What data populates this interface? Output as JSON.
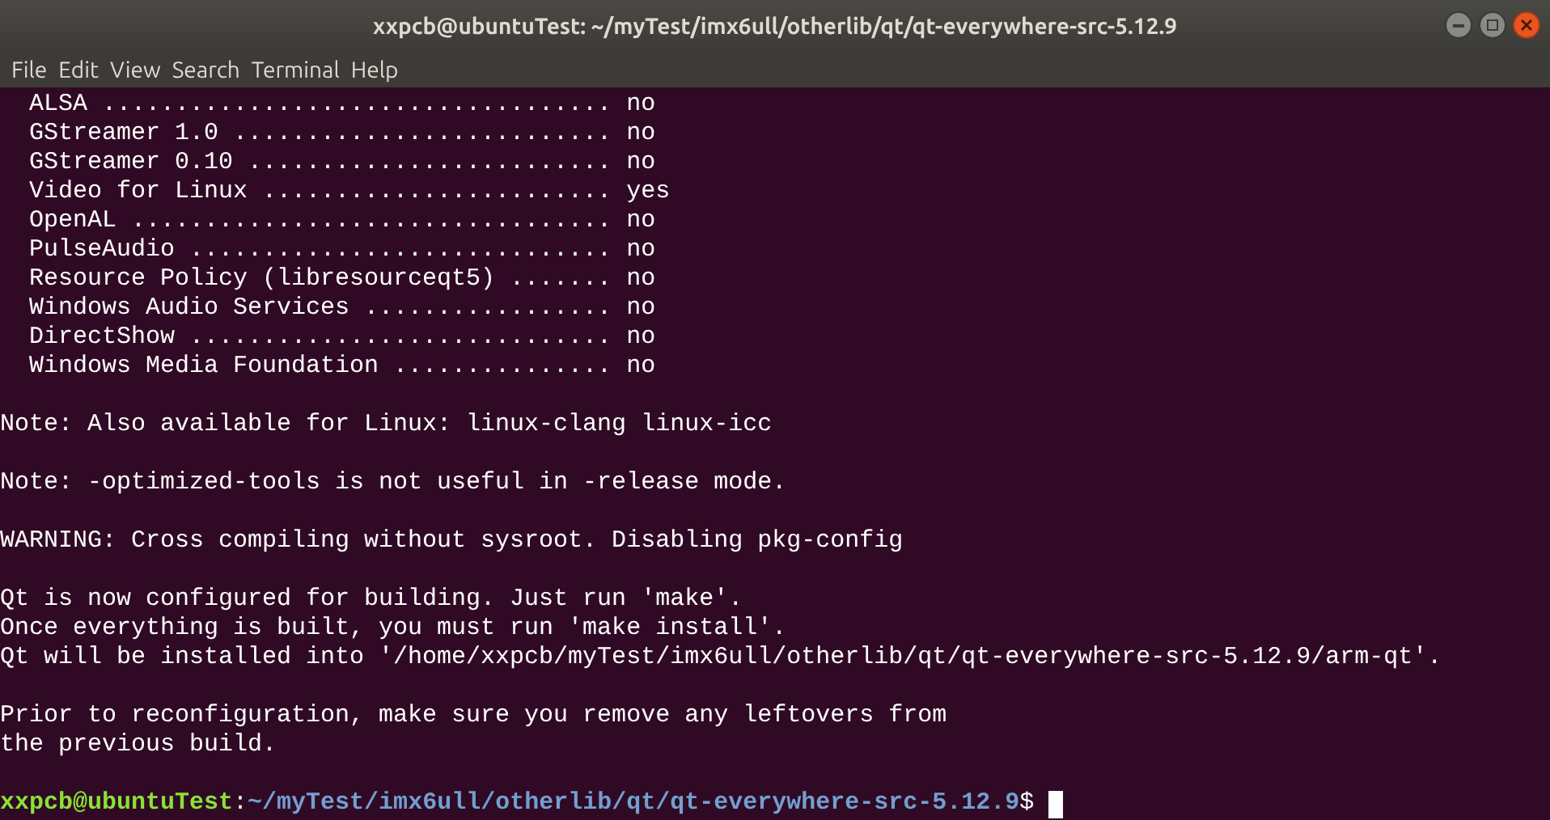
{
  "window": {
    "title": "xxpcb@ubuntuTest: ~/myTest/imx6ull/otherlib/qt/qt-everywhere-src-5.12.9"
  },
  "menu": [
    "File",
    "Edit",
    "View",
    "Search",
    "Terminal",
    "Help"
  ],
  "output_blocks": [
    [
      "  ALSA ................................... no",
      "  GStreamer 1.0 .......................... no",
      "  GStreamer 0.10 ......................... no",
      "  Video for Linux ........................ yes",
      "  OpenAL ................................. no",
      "  PulseAudio ............................. no",
      "  Resource Policy (libresourceqt5) ....... no",
      "  Windows Audio Services ................. no",
      "  DirectShow ............................. no",
      "  Windows Media Foundation ............... no"
    ],
    [
      "Note: Also available for Linux: linux-clang linux-icc"
    ],
    [
      "Note: -optimized-tools is not useful in -release mode."
    ],
    [
      "WARNING: Cross compiling without sysroot. Disabling pkg-config"
    ],
    [
      "Qt is now configured for building. Just run 'make'.",
      "Once everything is built, you must run 'make install'.",
      "Qt will be installed into '/home/xxpcb/myTest/imx6ull/otherlib/qt/qt-everywhere-src-5.12.9/arm-qt'."
    ],
    [
      "Prior to reconfiguration, make sure you remove any leftovers from",
      "the previous build."
    ]
  ],
  "prompt": {
    "user_host": "xxpcb@ubuntuTest",
    "separator": ":",
    "path": "~/myTest/imx6ull/otherlib/qt/qt-everywhere-src-5.12.9",
    "symbol": "$ "
  }
}
